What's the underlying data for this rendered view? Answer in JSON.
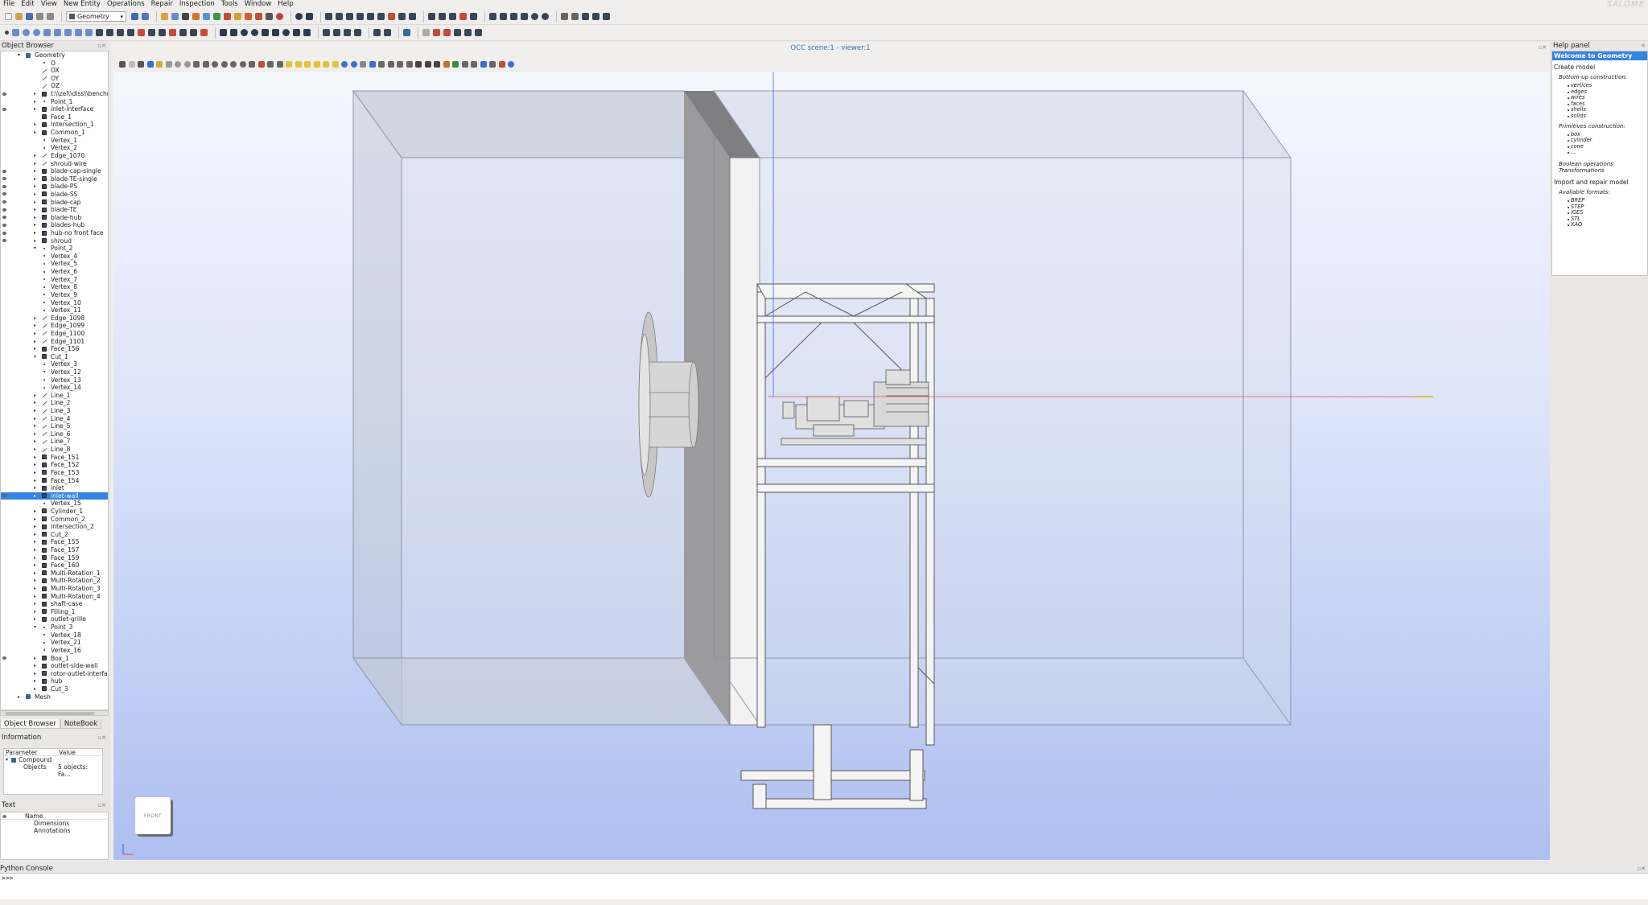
{
  "menu": [
    "File",
    "Edit",
    "View",
    "New Entity",
    "Operations",
    "Repair",
    "Inspection",
    "Tools",
    "Window",
    "Help"
  ],
  "brand": "SALOME",
  "module_select": {
    "label": "Geometry"
  },
  "object_browser": {
    "title": "Object Browser",
    "tree": [
      {
        "label": "Geometry",
        "depth": 0,
        "icon": "folder",
        "open": true
      },
      {
        "label": "O",
        "depth": 1,
        "icon": "vertex"
      },
      {
        "label": "OX",
        "depth": 1,
        "icon": "edge"
      },
      {
        "label": "OY",
        "depth": 1,
        "icon": "edge"
      },
      {
        "label": "OZ",
        "depth": 1,
        "icon": "edge"
      },
      {
        "label": "t:\\\\zel\\\\diss\\\\benchm",
        "depth": 1,
        "icon": "solid",
        "toggle": true,
        "eye": true
      },
      {
        "label": "Point_1",
        "depth": 1,
        "icon": "vertex",
        "toggle": true
      },
      {
        "label": "inlet-interface",
        "depth": 1,
        "icon": "solid",
        "toggle": true,
        "eye": true
      },
      {
        "label": "Face_1",
        "depth": 1,
        "icon": "solid"
      },
      {
        "label": "Intersection_1",
        "depth": 1,
        "icon": "solid",
        "toggle": true
      },
      {
        "label": "Common_1",
        "depth": 1,
        "icon": "solid",
        "toggle": true
      },
      {
        "label": "Vertex_1",
        "depth": 1,
        "icon": "vertex"
      },
      {
        "label": "Vertex_2",
        "depth": 1,
        "icon": "vertex"
      },
      {
        "label": "Edge_1070",
        "depth": 1,
        "icon": "edge",
        "toggle": true
      },
      {
        "label": "shroud-wire",
        "depth": 1,
        "icon": "edge",
        "toggle": true
      },
      {
        "label": "blade-cap-single",
        "depth": 1,
        "icon": "solid",
        "toggle": true,
        "eye": true
      },
      {
        "label": "blade-TE-single",
        "depth": 1,
        "icon": "solid",
        "toggle": true,
        "eye": true
      },
      {
        "label": "blade-PS",
        "depth": 1,
        "icon": "solid",
        "toggle": true,
        "eye": true
      },
      {
        "label": "blade-SS",
        "depth": 1,
        "icon": "solid",
        "toggle": true,
        "eye": true
      },
      {
        "label": "blade-cap",
        "depth": 1,
        "icon": "solid",
        "toggle": true,
        "eye": true
      },
      {
        "label": "blade-TE",
        "depth": 1,
        "icon": "solid",
        "toggle": true,
        "eye": true
      },
      {
        "label": "blade-hub",
        "depth": 1,
        "icon": "solid",
        "toggle": true,
        "eye": true
      },
      {
        "label": "blades-hub",
        "depth": 1,
        "icon": "solid",
        "toggle": true,
        "eye": true
      },
      {
        "label": "hub-no front face",
        "depth": 1,
        "icon": "solid",
        "toggle": true,
        "eye": true
      },
      {
        "label": "shroud",
        "depth": 1,
        "icon": "solid",
        "toggle": true,
        "eye": true
      },
      {
        "label": "Point_2",
        "depth": 1,
        "icon": "vertex",
        "toggle": true,
        "open": true
      },
      {
        "label": "Vertex_4",
        "depth": 1,
        "icon": "vertex"
      },
      {
        "label": "Vertex_5",
        "depth": 1,
        "icon": "vertex"
      },
      {
        "label": "Vertex_6",
        "depth": 1,
        "icon": "vertex"
      },
      {
        "label": "Vertex_7",
        "depth": 1,
        "icon": "vertex"
      },
      {
        "label": "Vertex_8",
        "depth": 1,
        "icon": "vertex"
      },
      {
        "label": "Vertex_9",
        "depth": 1,
        "icon": "vertex"
      },
      {
        "label": "Vertex_10",
        "depth": 1,
        "icon": "vertex"
      },
      {
        "label": "Vertex_11",
        "depth": 1,
        "icon": "vertex"
      },
      {
        "label": "Edge_1098",
        "depth": 1,
        "icon": "edge",
        "toggle": true
      },
      {
        "label": "Edge_1099",
        "depth": 1,
        "icon": "edge",
        "toggle": true
      },
      {
        "label": "Edge_1100",
        "depth": 1,
        "icon": "edge",
        "toggle": true
      },
      {
        "label": "Edge_1101",
        "depth": 1,
        "icon": "edge",
        "toggle": true
      },
      {
        "label": "Face_156",
        "depth": 1,
        "icon": "solid",
        "toggle": true
      },
      {
        "label": "Cut_1",
        "depth": 1,
        "icon": "solid",
        "toggle": true,
        "open": true
      },
      {
        "label": "Vertex_3",
        "depth": 1,
        "icon": "vertex"
      },
      {
        "label": "Vertex_12",
        "depth": 1,
        "icon": "vertex"
      },
      {
        "label": "Vertex_13",
        "depth": 1,
        "icon": "vertex"
      },
      {
        "label": "Vertex_14",
        "depth": 1,
        "icon": "vertex"
      },
      {
        "label": "Line_1",
        "depth": 1,
        "icon": "edge",
        "toggle": true
      },
      {
        "label": "Line_2",
        "depth": 1,
        "icon": "edge",
        "toggle": true
      },
      {
        "label": "Line_3",
        "depth": 1,
        "icon": "edge",
        "toggle": true
      },
      {
        "label": "Line_4",
        "depth": 1,
        "icon": "edge",
        "toggle": true
      },
      {
        "label": "Line_5",
        "depth": 1,
        "icon": "edge",
        "toggle": true
      },
      {
        "label": "Line_6",
        "depth": 1,
        "icon": "edge",
        "toggle": true
      },
      {
        "label": "Line_7",
        "depth": 1,
        "icon": "edge",
        "toggle": true
      },
      {
        "label": "Line_8",
        "depth": 1,
        "icon": "edge",
        "toggle": true
      },
      {
        "label": "Face_151",
        "depth": 1,
        "icon": "solid",
        "toggle": true
      },
      {
        "label": "Face_152",
        "depth": 1,
        "icon": "solid",
        "toggle": true
      },
      {
        "label": "Face_153",
        "depth": 1,
        "icon": "solid",
        "toggle": true
      },
      {
        "label": "Face_154",
        "depth": 1,
        "icon": "solid",
        "toggle": true
      },
      {
        "label": "inlet",
        "depth": 1,
        "icon": "solid",
        "toggle": true
      },
      {
        "label": "inlet-wall",
        "depth": 1,
        "icon": "solid",
        "toggle": true,
        "selected": true,
        "eye": true
      },
      {
        "label": "Vertex_15",
        "depth": 1,
        "icon": "vertex"
      },
      {
        "label": "Cylinder_1",
        "depth": 1,
        "icon": "solid",
        "toggle": true
      },
      {
        "label": "Common_2",
        "depth": 1,
        "icon": "solid",
        "toggle": true
      },
      {
        "label": "Intersection_2",
        "depth": 1,
        "icon": "solid",
        "toggle": true
      },
      {
        "label": "Cut_2",
        "depth": 1,
        "icon": "solid",
        "toggle": true
      },
      {
        "label": "Face_155",
        "depth": 1,
        "icon": "solid",
        "toggle": true
      },
      {
        "label": "Face_157",
        "depth": 1,
        "icon": "solid",
        "toggle": true
      },
      {
        "label": "Face_159",
        "depth": 1,
        "icon": "solid",
        "toggle": true
      },
      {
        "label": "Face_160",
        "depth": 1,
        "icon": "solid",
        "toggle": true
      },
      {
        "label": "Multi-Rotation_1",
        "depth": 1,
        "icon": "solid",
        "toggle": true
      },
      {
        "label": "Multi-Rotation_2",
        "depth": 1,
        "icon": "solid",
        "toggle": true
      },
      {
        "label": "Multi-Rotation_3",
        "depth": 1,
        "icon": "solid",
        "toggle": true
      },
      {
        "label": "Multi-Rotation_4",
        "depth": 1,
        "icon": "solid",
        "toggle": true
      },
      {
        "label": "shaft-case",
        "depth": 1,
        "icon": "solid",
        "toggle": true
      },
      {
        "label": "Filling_1",
        "depth": 1,
        "icon": "solid",
        "toggle": true
      },
      {
        "label": "outlet-grille",
        "depth": 1,
        "icon": "solid",
        "toggle": true
      },
      {
        "label": "Point_3",
        "depth": 1,
        "icon": "vertex",
        "toggle": true,
        "open": true
      },
      {
        "label": "Vertex_18",
        "depth": 1,
        "icon": "vertex"
      },
      {
        "label": "Vertex_21",
        "depth": 1,
        "icon": "vertex"
      },
      {
        "label": "Vertex_16",
        "depth": 1,
        "icon": "vertex"
      },
      {
        "label": "Box_1",
        "depth": 1,
        "icon": "solid",
        "toggle": true,
        "eye": true
      },
      {
        "label": "outlet-side-wall",
        "depth": 1,
        "icon": "solid",
        "toggle": true
      },
      {
        "label": "rotor-outlet-interfac",
        "depth": 1,
        "icon": "solid",
        "toggle": true
      },
      {
        "label": "hub",
        "depth": 1,
        "icon": "solid",
        "toggle": true
      },
      {
        "label": "Cut_3",
        "depth": 1,
        "icon": "solid",
        "toggle": true
      },
      {
        "label": "Mesh",
        "depth": 0,
        "icon": "folder",
        "toggle": true
      }
    ]
  },
  "bottom_tabs": [
    "Object Browser",
    "NoteBook"
  ],
  "information": {
    "title": "Information",
    "columns": [
      "Parameter",
      "Value"
    ],
    "rows": [
      {
        "param": "Compound",
        "value": "",
        "toggle": true
      },
      {
        "param": "Objects",
        "value": "5 objects: Fa..."
      }
    ]
  },
  "text_panel": {
    "title": "Text",
    "column": "Name",
    "rows": [
      "Dimensions",
      "Annotations"
    ]
  },
  "viewer": {
    "title": "OCC scene:1 - viewer:1",
    "view_cube_label": "FRONT"
  },
  "help_panel": {
    "title": "Help panel",
    "welcome": "Welcome to Geometry",
    "create_model": "Create model",
    "bottom_up": "Bottom-up construction:",
    "bottom_up_items": [
      "vertices",
      "edges",
      "wires",
      "faces",
      "shells",
      "solids"
    ],
    "primitives": "Primitives construction:",
    "primitive_items": [
      "box",
      "cylinder",
      "cone",
      "..."
    ],
    "boolean": "Boolean operations",
    "transformations": "Transformations",
    "import_repair": "Import and repair model",
    "formats_title": "Available formats:",
    "formats": [
      "BREP",
      "STEP",
      "IGES",
      "STL",
      "XAO"
    ]
  },
  "python_console": {
    "title": "Python Console",
    "prompt": ">>>"
  },
  "colors": {
    "accent": "#3584e4",
    "viewer_top": "#f5f7fe",
    "viewer_bottom": "#aebff0",
    "x_axis": "#e05a4a",
    "z_axis": "#3a6fd8"
  }
}
